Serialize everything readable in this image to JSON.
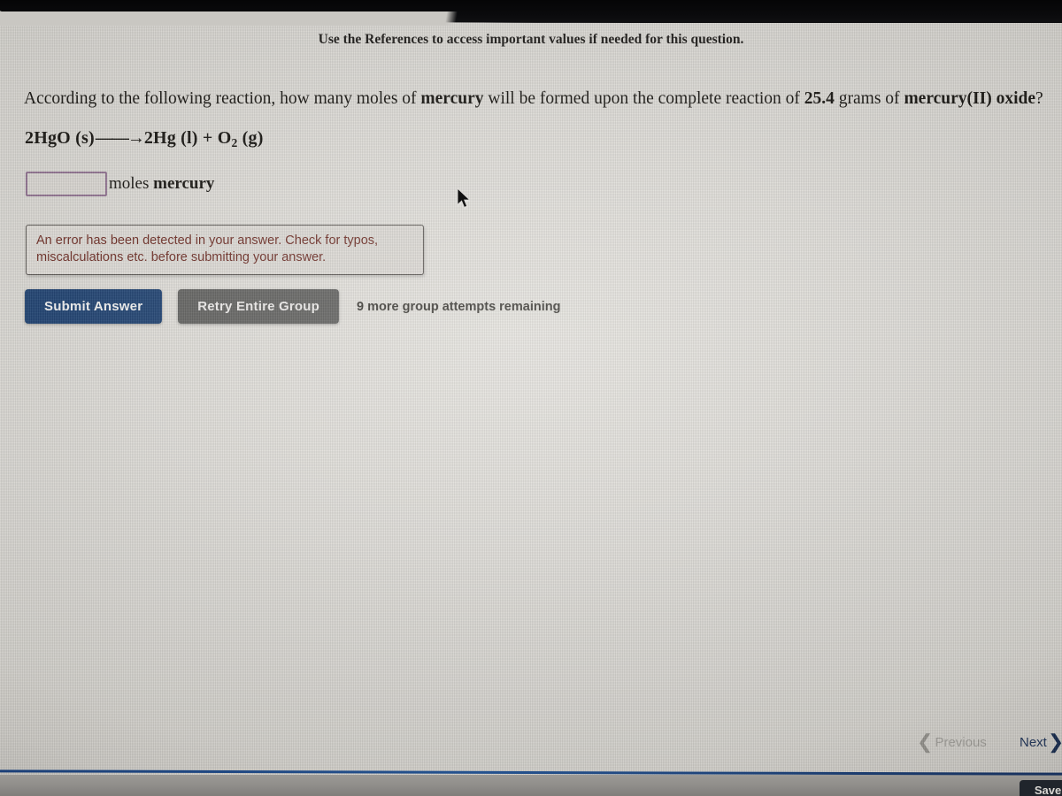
{
  "header": {
    "references_link": "[References]",
    "instruction": "Use the References to access important values if needed for this question."
  },
  "question": {
    "text_part1": "According to the following reaction, how many moles of ",
    "bold1": "mercury",
    "text_part2": " will be formed upon the complete reaction of ",
    "bold2": "25.4",
    "text_part3": " grams of ",
    "bold3": "mercury(II) oxide",
    "text_part4": "?",
    "equation": {
      "reactant": "2HgO (s)",
      "arrow": "——→",
      "product_1": "2Hg (l)",
      "plus": "+",
      "product_2_formula": "O",
      "product_2_subscript": "2",
      "product_2_state": " (g)"
    }
  },
  "answer": {
    "value": "",
    "placeholder": "",
    "unit_prefix": "moles ",
    "unit_bold": "mercury"
  },
  "error": {
    "message": "An error has been detected in your answer. Check for typos, miscalculations etc. before submitting your answer.",
    "color": "#6b2a22"
  },
  "actions": {
    "submit_label": "Submit Answer",
    "retry_label": "Retry Entire Group",
    "attempts_text": "9 more group attempts remaining",
    "submit_color": "#1c3f6e",
    "retry_color": "#5f5f5d"
  },
  "navigation": {
    "previous_label": "Previous",
    "previous_chevron": "❮",
    "next_label": "Next",
    "next_chevron": "❯",
    "save_label": "Save"
  },
  "theme": {
    "link_color": "#3fb8e0",
    "input_border": "#8d6f8d",
    "rule_color": "#24528f"
  }
}
